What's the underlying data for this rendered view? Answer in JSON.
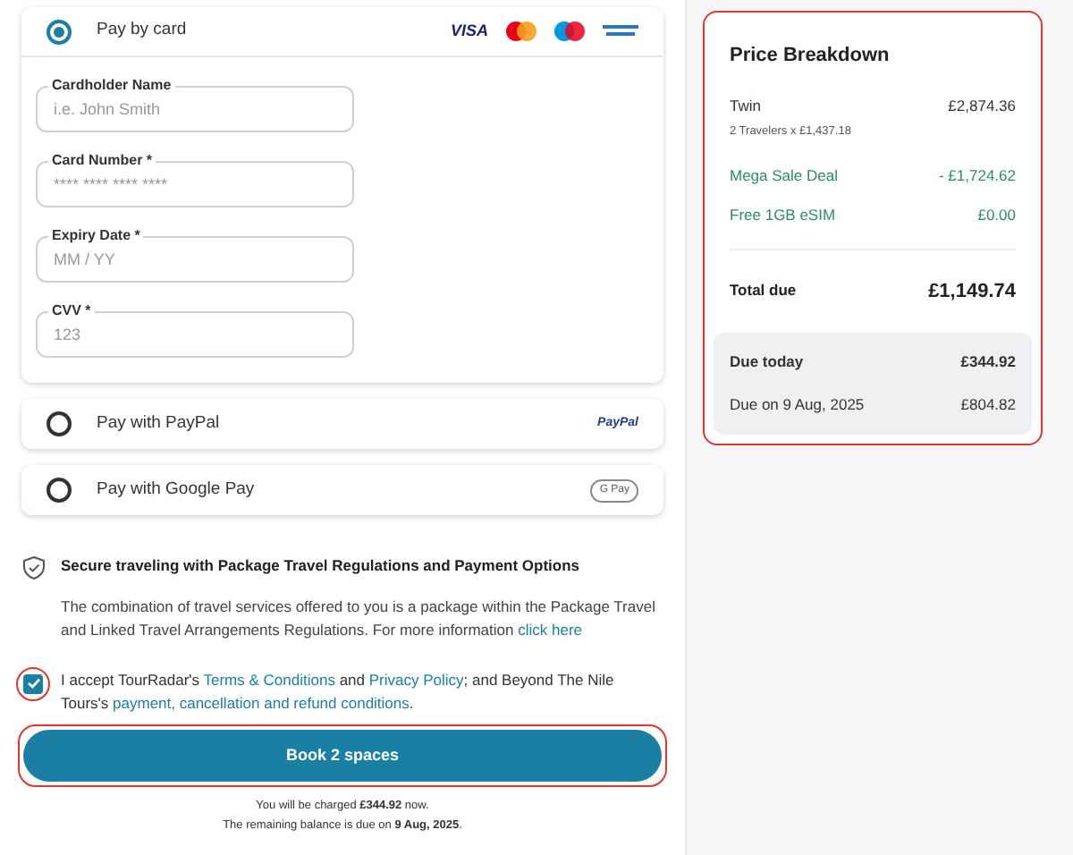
{
  "payment_methods": [
    {
      "kind": "card",
      "label": "Pay by card",
      "selected": true,
      "logos": [
        "VISA"
      ],
      "fields": [
        {
          "label": "Cardholder Name",
          "placeholder": "i.e. John Smith"
        },
        {
          "label": "Card Number *",
          "placeholder": "**** **** **** ****"
        },
        {
          "label": "Expiry Date *",
          "placeholder": "MM / YY"
        },
        {
          "label": "CVV *",
          "placeholder": "123"
        }
      ]
    },
    {
      "kind": "paypal",
      "label": "Pay with PayPal",
      "selected": false,
      "logos": [
        "PayPal"
      ]
    },
    {
      "kind": "gpay",
      "label": "Pay with Google Pay",
      "selected": false,
      "logos": [
        "G Pay"
      ]
    }
  ],
  "secure": {
    "title": "Secure traveling with Package Travel Regulations and Payment Options",
    "parts": [
      {
        "kind": "text",
        "text": "The combination of travel services offered to you is a package within the Package Travel and Linked Travel Arrangements Regulations. For more information "
      },
      {
        "kind": "link",
        "text": "click here"
      }
    ]
  },
  "agreement": {
    "checked": true,
    "highlighted": true,
    "parts": [
      {
        "kind": "text",
        "text": "I accept TourRadar's "
      },
      {
        "kind": "link",
        "text": "Terms & Conditions"
      },
      {
        "kind": "text",
        "text": " and "
      },
      {
        "kind": "link",
        "text": "Privacy Policy"
      },
      {
        "kind": "text",
        "text": "; and Beyond The Nile Tours's "
      },
      {
        "kind": "link",
        "text": "payment, cancellation and refund conditions"
      },
      {
        "kind": "text",
        "text": "."
      }
    ]
  },
  "book_button": {
    "label": "Book 2 spaces",
    "highlighted": true
  },
  "charge_notes": [
    "You will be charged **£344.92** now.",
    "The remaining balance is due on **9 Aug, 2025**."
  ],
  "price_breakdown": {
    "title": "Price Breakdown",
    "highlighted": true,
    "room": {
      "name": "Twin",
      "amount": "£2,874.36",
      "detail": "2 Travelers x £1,437.18"
    },
    "discounts": [
      {
        "name": "Mega Sale Deal",
        "amount": "- £1,724.62"
      },
      {
        "name": "Free 1GB eSIM",
        "amount": "£0.00"
      }
    ],
    "total": {
      "label": "Total due",
      "amount": "£1,149.74"
    },
    "schedule": [
      {
        "label": "Due today",
        "amount": "£344.92",
        "emphasis": true
      },
      {
        "label": "Due on 9 Aug, 2025",
        "amount": "£804.82",
        "emphasis": false
      }
    ]
  }
}
